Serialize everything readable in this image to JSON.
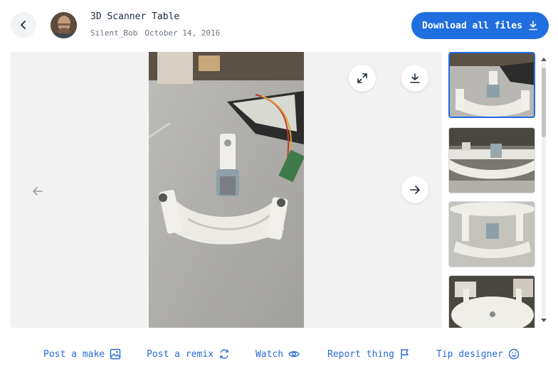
{
  "header": {
    "title": "3D Scanner Table",
    "author": "Silent_Bob",
    "date": "October 14, 2016",
    "download_all_label": "Download all files"
  },
  "viewer": {
    "icons": {
      "expand": "expand-icon",
      "download": "download-icon",
      "prev": "arrow-left-icon",
      "next": "arrow-right-icon"
    },
    "thumbnails_count": 4,
    "active_thumbnail": 1
  },
  "actions": [
    {
      "label": "Post a make",
      "icon": "image-icon"
    },
    {
      "label": "Post a remix",
      "icon": "remix-icon"
    },
    {
      "label": "Watch",
      "icon": "eye-icon"
    },
    {
      "label": "Report thing",
      "icon": "flag-icon"
    },
    {
      "label": "Tip designer",
      "icon": "smile-icon"
    }
  ],
  "colors": {
    "accent": "#1f6fe0",
    "link": "#2a6ad8",
    "viewer_bg": "#f2f2f3"
  }
}
